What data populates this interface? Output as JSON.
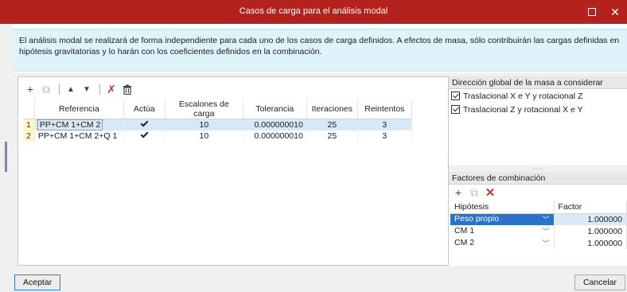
{
  "window": {
    "title": "Casos de carga para el análisis modal",
    "maximize_icon": "maximize-icon",
    "close_glyph": "✕"
  },
  "info_text": "El análisis modal se realizará de forma independiente para cada uno de los casos de carga definidos. A efectos de masa, sólo contribuirán las cargas definidas en hipótesis gravitatorias y lo harán con los coeficientes definidos en la combinación.",
  "toolbar": {
    "icons": [
      "add-icon",
      "copy-icon",
      "move-up-icon",
      "move-down-icon",
      "delete-marked-icon",
      "delete-icon"
    ],
    "glyphs": {
      "add": "+",
      "copy": "⧉",
      "up": "▲",
      "down": "▼",
      "delmark": "✗",
      "trash": "🗑"
    }
  },
  "grid": {
    "columns": [
      "Referencia",
      "Actúa",
      "Escalones de carga",
      "Tolerancia",
      "Iteraciones",
      "Reintentos"
    ],
    "rows": [
      {
        "num": "1",
        "referencia": "PP+CM 1+CM 2",
        "actua": true,
        "escalones": "10",
        "tolerancia": "0.000000010",
        "iteraciones": "25",
        "reintentos": "3",
        "selected": true
      },
      {
        "num": "2",
        "referencia": "PP+CM 1+CM 2+Q 1",
        "actua": true,
        "escalones": "10",
        "tolerancia": "0.000000010",
        "iteraciones": "25",
        "reintentos": "3",
        "selected": false
      }
    ]
  },
  "mass_direction": {
    "header": "Dirección global de la masa a considerar",
    "options": [
      {
        "label": "Traslacional X e Y y rotacional Z",
        "checked": true
      },
      {
        "label": "Traslacional Z y rotacional X e Y",
        "checked": true
      }
    ]
  },
  "combination": {
    "header": "Factores de combinación",
    "icons": [
      "add-icon",
      "copy-icon",
      "delete-icon"
    ],
    "columns": [
      "Hipótesis",
      "Factor"
    ],
    "rows": [
      {
        "hipotesis": "Peso propio",
        "factor": "1.000000",
        "selected": true
      },
      {
        "hipotesis": "CM 1",
        "factor": "1.000000",
        "selected": false
      },
      {
        "hipotesis": "CM 2",
        "factor": "1.000000",
        "selected": false
      }
    ]
  },
  "footer": {
    "accept": "Aceptar",
    "cancel": "Cancelar"
  },
  "colors": {
    "titlebar": "#b3221d",
    "info_bg": "#dff3fb",
    "selection": "#2b73c9",
    "row_number_bg": "#fff7c8"
  }
}
